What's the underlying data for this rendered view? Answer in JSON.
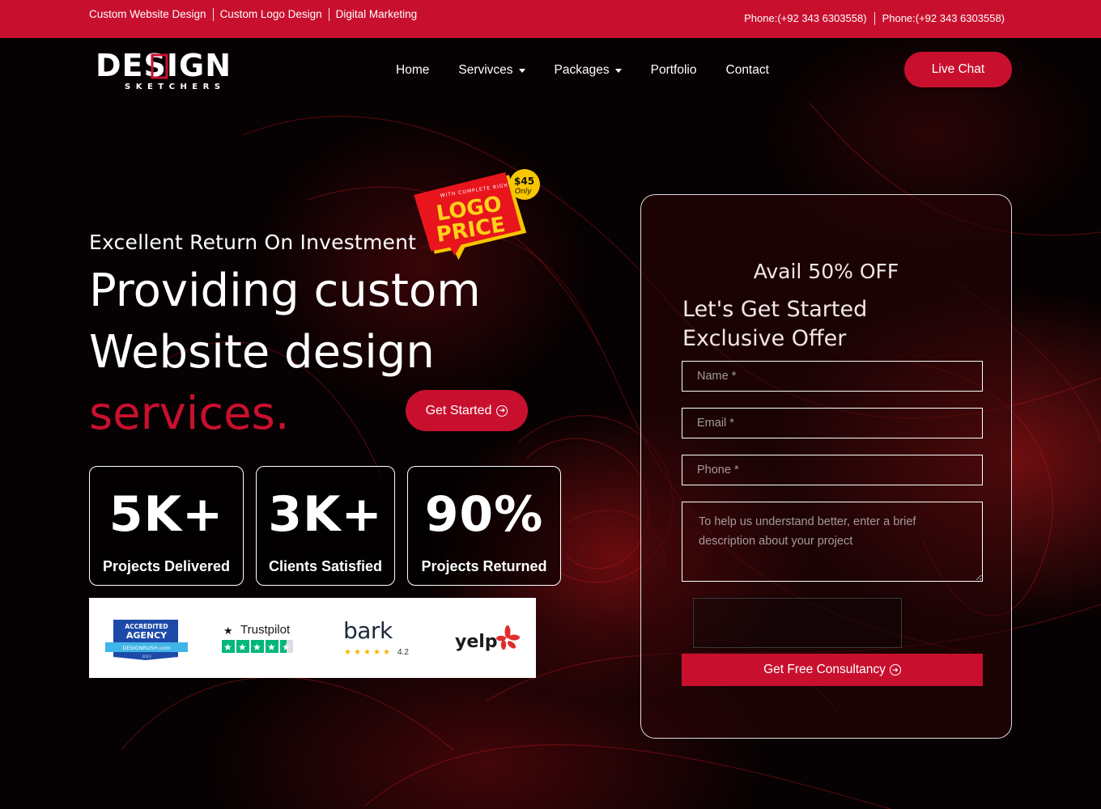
{
  "topbar": {
    "links": [
      "Custom Website Design",
      "Custom Logo Design",
      "Digital Marketing"
    ],
    "phones": [
      "Phone:(+92 343 6303558)",
      "Phone:(+92 343 6303558)"
    ]
  },
  "brand": {
    "word": "DESIGN",
    "tagline": "SKETCHERS"
  },
  "nav": {
    "items": [
      {
        "label": "Home",
        "dropdown": false
      },
      {
        "label": "Servivces",
        "dropdown": true
      },
      {
        "label": "Packages",
        "dropdown": true
      },
      {
        "label": "Portfolio",
        "dropdown": false
      },
      {
        "label": "Contact",
        "dropdown": false
      }
    ],
    "live_chat": "Live Chat"
  },
  "promo_badge": {
    "top": "WITH COMPLETE RIGHTS",
    "line1": "LOGO",
    "line2": "PRICE",
    "price": "$45",
    "price_note": "Only"
  },
  "hero": {
    "eyebrow": "Excellent Return On Investment",
    "line1": "Providing custom",
    "line2": "Website design",
    "accent": "services.",
    "cta": "Get Started"
  },
  "stats": [
    {
      "value": "5K+",
      "label": "Projects Delivered"
    },
    {
      "value": "3K+",
      "label": "Clients Satisfied"
    },
    {
      "value": "90%",
      "label": "Projects Returned"
    }
  ],
  "trust_logos": {
    "designrush": {
      "line1": "ACCREDITED",
      "line2": "AGENCY",
      "line3": "DESIGNRUSH.com",
      "year": "2023"
    },
    "trustpilot": {
      "name": "Trustpilot"
    },
    "bark": {
      "name": "bark",
      "rating": "4.2"
    },
    "yelp": {
      "name": "yelp"
    }
  },
  "form": {
    "offer": "Avail 50% OFF",
    "title_line1": "Let's Get Started",
    "title_line2": "Exclusive Offer",
    "name_placeholder": "Name *",
    "email_placeholder": "Email *",
    "phone_placeholder": "Phone *",
    "message_placeholder": "To help us understand better, enter a brief description about your project",
    "submit": "Get Free Consultancy"
  },
  "colors": {
    "brand_red": "#c8102e",
    "background": "#070203",
    "text": "#ffffff"
  },
  "icons": [
    "arrow-right-circle-icon",
    "caret-down-icon",
    "star-icon",
    "yelp-burst-icon"
  ]
}
